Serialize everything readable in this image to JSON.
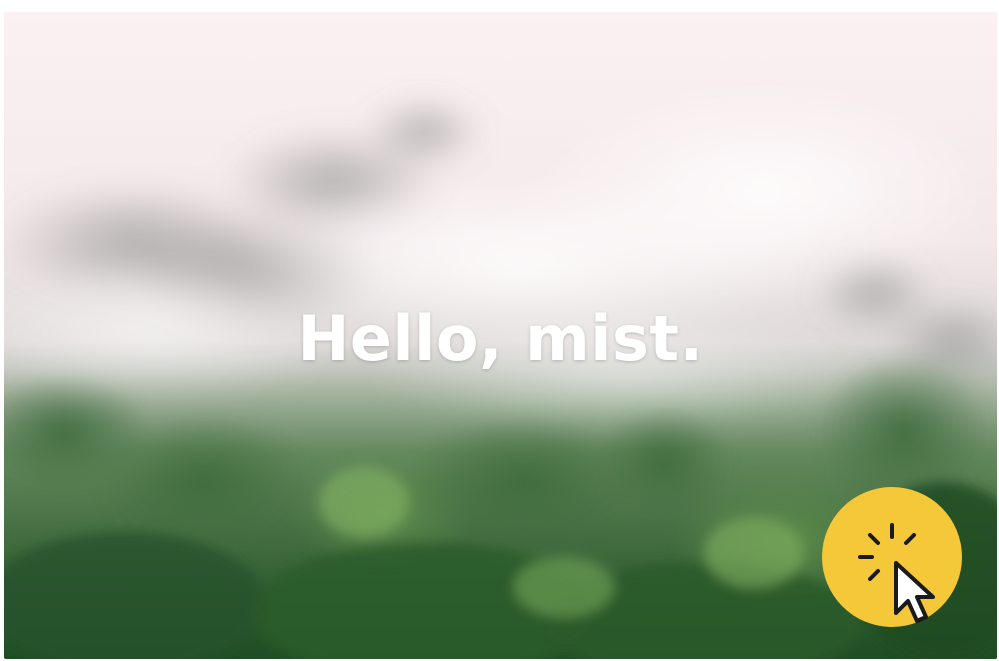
{
  "hero": {
    "headline": "Hello, mist."
  },
  "click_badge": {
    "icon": "click-cursor-icon",
    "badge_color": "#F5C83A"
  },
  "colors": {
    "mist": "#F6ECEE",
    "forest_dark": "#1E4A24",
    "forest_mid": "#3F7A3A",
    "forest_light": "#6FA35A"
  }
}
